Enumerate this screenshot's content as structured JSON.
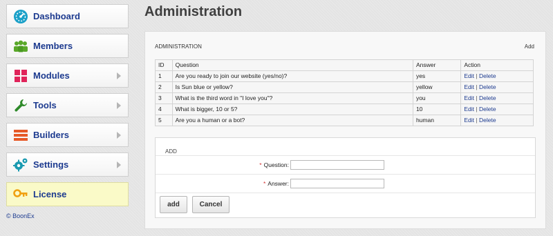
{
  "sidebar": {
    "items": [
      {
        "label": "Dashboard",
        "icon": "dashboard-icon",
        "has_arrow": false
      },
      {
        "label": "Members",
        "icon": "members-icon",
        "has_arrow": false
      },
      {
        "label": "Modules",
        "icon": "modules-icon",
        "has_arrow": true
      },
      {
        "label": "Tools",
        "icon": "wrench-icon",
        "has_arrow": true
      },
      {
        "label": "Builders",
        "icon": "builders-icon",
        "has_arrow": true
      },
      {
        "label": "Settings",
        "icon": "gears-icon",
        "has_arrow": true
      },
      {
        "label": "License",
        "icon": "key-icon",
        "has_arrow": false
      }
    ],
    "copyright": "© BoonEx"
  },
  "page": {
    "title": "Administration"
  },
  "admin_section": {
    "caption": "ADMINISTRATION",
    "add_link": "Add",
    "columns": [
      "ID",
      "Question",
      "Answer",
      "Action"
    ],
    "rows": [
      {
        "id": "1",
        "question": "Are you ready to join our website (yes/no)?",
        "answer": "yes"
      },
      {
        "id": "2",
        "question": "Is Sun blue or yellow?",
        "answer": "yellow"
      },
      {
        "id": "3",
        "question": "What is the third word in \"I love you\"?",
        "answer": "you"
      },
      {
        "id": "4",
        "question": "What is bigger, 10 or 5?",
        "answer": "10"
      },
      {
        "id": "5",
        "question": "Are you a human or a bot?",
        "answer": "human"
      }
    ],
    "edit_label": "Edit",
    "separator": "|",
    "delete_label": "Delete"
  },
  "add_form": {
    "caption": "ADD",
    "required_mark": "*",
    "question_label": "Question:",
    "answer_label": "Answer:",
    "question_value": "",
    "answer_value": "",
    "add_button": "add",
    "cancel_button": "Cancel"
  },
  "colors": {
    "link": "#1c3a8f",
    "dashboard_icon": "#1aa0c8",
    "members_icon": "#5aa82a",
    "modules_icon": "#e0245a",
    "tools_icon": "#2f8a2a",
    "builders_icon": "#e65a28",
    "settings_icon": "#1a9ab0",
    "license_icon": "#f0a010",
    "required": "#d23232"
  }
}
